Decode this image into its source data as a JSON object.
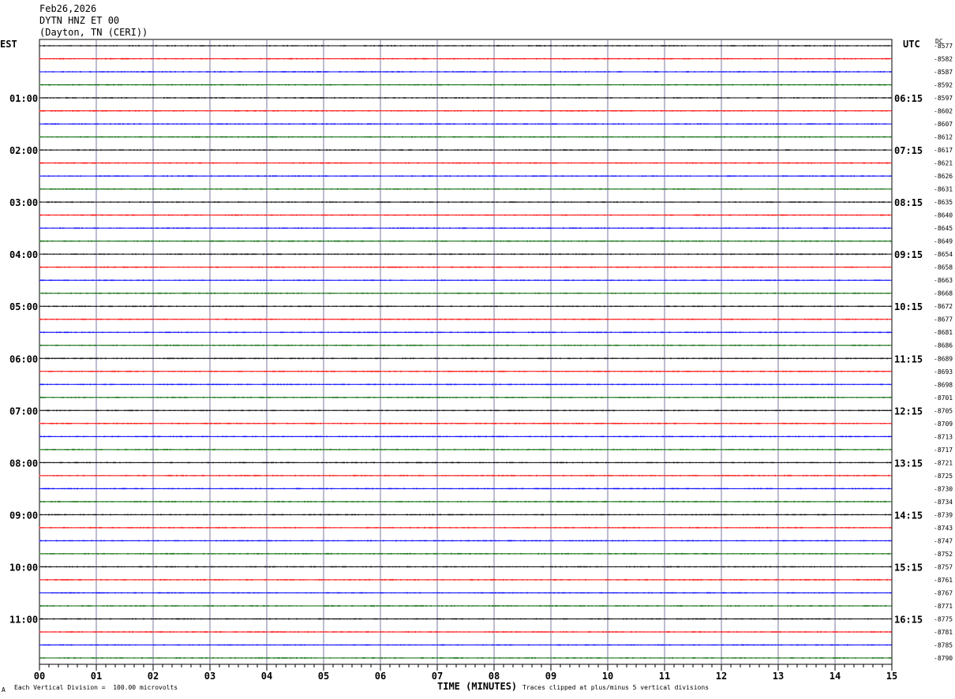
{
  "header": {
    "date": "Feb26,2026",
    "station": "DYTN HNZ ET 00",
    "location": "(Dayton, TN (CERI))"
  },
  "timezones": {
    "left": "EST",
    "right": "UTC",
    "dc_label": "DC"
  },
  "footer": {
    "scale": "Each Vertical Division =  100.00 microvolts",
    "xlabel": "TIME (MINUTES)",
    "clip": "Traces clipped at plus/minus 5 vertical divisions",
    "corner_mark": "A"
  },
  "colors": {
    "trace_cycle": [
      "#000000",
      "#ff0000",
      "#0000ff",
      "#006400"
    ],
    "grid": "#7a7aa0"
  },
  "chart_data": {
    "type": "line",
    "title": "DYTN HNZ ET 00",
    "xlabel": "TIME (MINUTES)",
    "xlim": [
      0,
      15
    ],
    "x_ticks": [
      "00",
      "01",
      "02",
      "03",
      "04",
      "05",
      "06",
      "07",
      "08",
      "09",
      "10",
      "11",
      "12",
      "13",
      "14",
      "15"
    ],
    "trace_count": 48,
    "minutes_per_trace": 15,
    "left_time_labels": [
      "01:00",
      "02:00",
      "03:00",
      "04:00",
      "05:00",
      "06:00",
      "07:00",
      "08:00",
      "09:00",
      "10:00",
      "11:00"
    ],
    "right_time_labels": [
      "06:15",
      "07:15",
      "08:15",
      "09:15",
      "10:15",
      "11:15",
      "12:15",
      "13:15",
      "14:15",
      "15:15",
      "16:15"
    ],
    "dc_offsets": [
      "-8577",
      "-8582",
      "-8587",
      "-8592",
      "-8597",
      "-8602",
      "-8607",
      "-8612",
      "-8617",
      "-8621",
      "-8626",
      "-8631",
      "-8635",
      "-8640",
      "-8645",
      "-8649",
      "-8654",
      "-8658",
      "-8663",
      "-8668",
      "-8672",
      "-8677",
      "-8681",
      "-8686",
      "-8689",
      "-8693",
      "-8698",
      "-8701",
      "-8705",
      "-8709",
      "-8713",
      "-8717",
      "-8721",
      "-8725",
      "-8730",
      "-8734",
      "-8739",
      "-8743",
      "-8747",
      "-8752",
      "-8757",
      "-8761",
      "-8767",
      "-8771",
      "-8775",
      "-8781",
      "-8785",
      "-8790"
    ]
  }
}
